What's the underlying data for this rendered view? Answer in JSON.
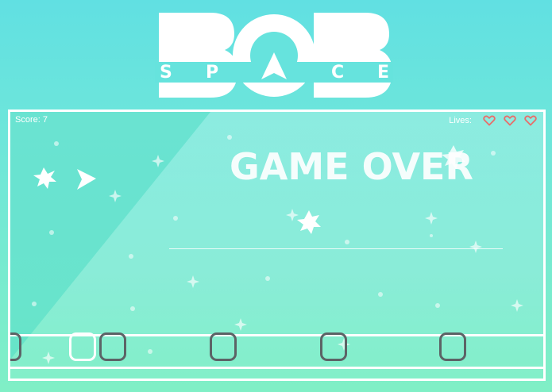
{
  "logo": {
    "big_letters": [
      "B",
      "O",
      "B"
    ],
    "small_letters": [
      "S",
      "P",
      "A",
      "C",
      "E"
    ]
  },
  "hud": {
    "score_label": "Score: 7",
    "lives_label": "Lives:",
    "lives_count": 3,
    "heart_icon": "heart-outline-icon",
    "heart_color": "#e86e6a"
  },
  "game": {
    "status_text": "GAME OVER"
  },
  "colors": {
    "background_top": "#61e0e2",
    "background_bottom": "#80efc6",
    "frame": "#ffffff",
    "slot_border": "#5c6366"
  }
}
